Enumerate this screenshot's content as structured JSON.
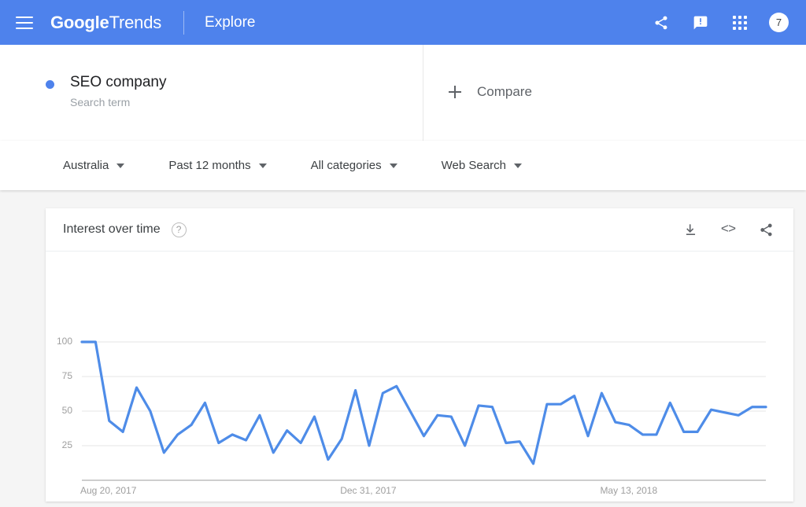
{
  "appbar": {
    "menu_icon": "hamburger-icon",
    "brand_bold": "Google",
    "brand_light": "Trends",
    "explore": "Explore",
    "share_icon": "share-icon",
    "feedback_icon": "feedback-icon",
    "apps_icon": "apps-grid-icon",
    "avatar_text": "7",
    "bg_color": "#4e82ec"
  },
  "query": {
    "term": "SEO company",
    "subtitle": "Search term",
    "dot_color": "#4e82ec",
    "compare_label": "Compare",
    "plus_icon": "plus-icon"
  },
  "filters": [
    {
      "label": "Australia"
    },
    {
      "label": "Past 12 months"
    },
    {
      "label": "All categories"
    },
    {
      "label": "Web Search"
    }
  ],
  "card": {
    "title": "Interest over time",
    "help_icon": "help-question-icon",
    "help_glyph": "?",
    "download_icon": "download-icon",
    "embed_icon": "embed-code-icon",
    "embed_glyph": "<>",
    "share_icon": "share-icon"
  },
  "chart_data": {
    "type": "line",
    "title": "Interest over time",
    "xlabel": "",
    "ylabel": "",
    "ylim": [
      0,
      100
    ],
    "yticks": [
      25,
      50,
      75,
      100
    ],
    "xticks": [
      "Aug 20, 2017",
      "Dec 31, 2017",
      "May 13, 2018"
    ],
    "xtick_index": [
      0,
      19,
      38
    ],
    "grid": true,
    "legend": false,
    "line_color": "#4e8ce8",
    "series": [
      {
        "name": "SEO company",
        "values": [
          100,
          100,
          43,
          35,
          67,
          50,
          20,
          33,
          40,
          56,
          27,
          33,
          29,
          47,
          20,
          36,
          27,
          46,
          15,
          30,
          65,
          25,
          63,
          68,
          50,
          32,
          47,
          46,
          25,
          54,
          53,
          27,
          28,
          12,
          55,
          55,
          61,
          32,
          63,
          42,
          40,
          33,
          33,
          56,
          35,
          35,
          51,
          49,
          47,
          53,
          53
        ]
      }
    ]
  }
}
